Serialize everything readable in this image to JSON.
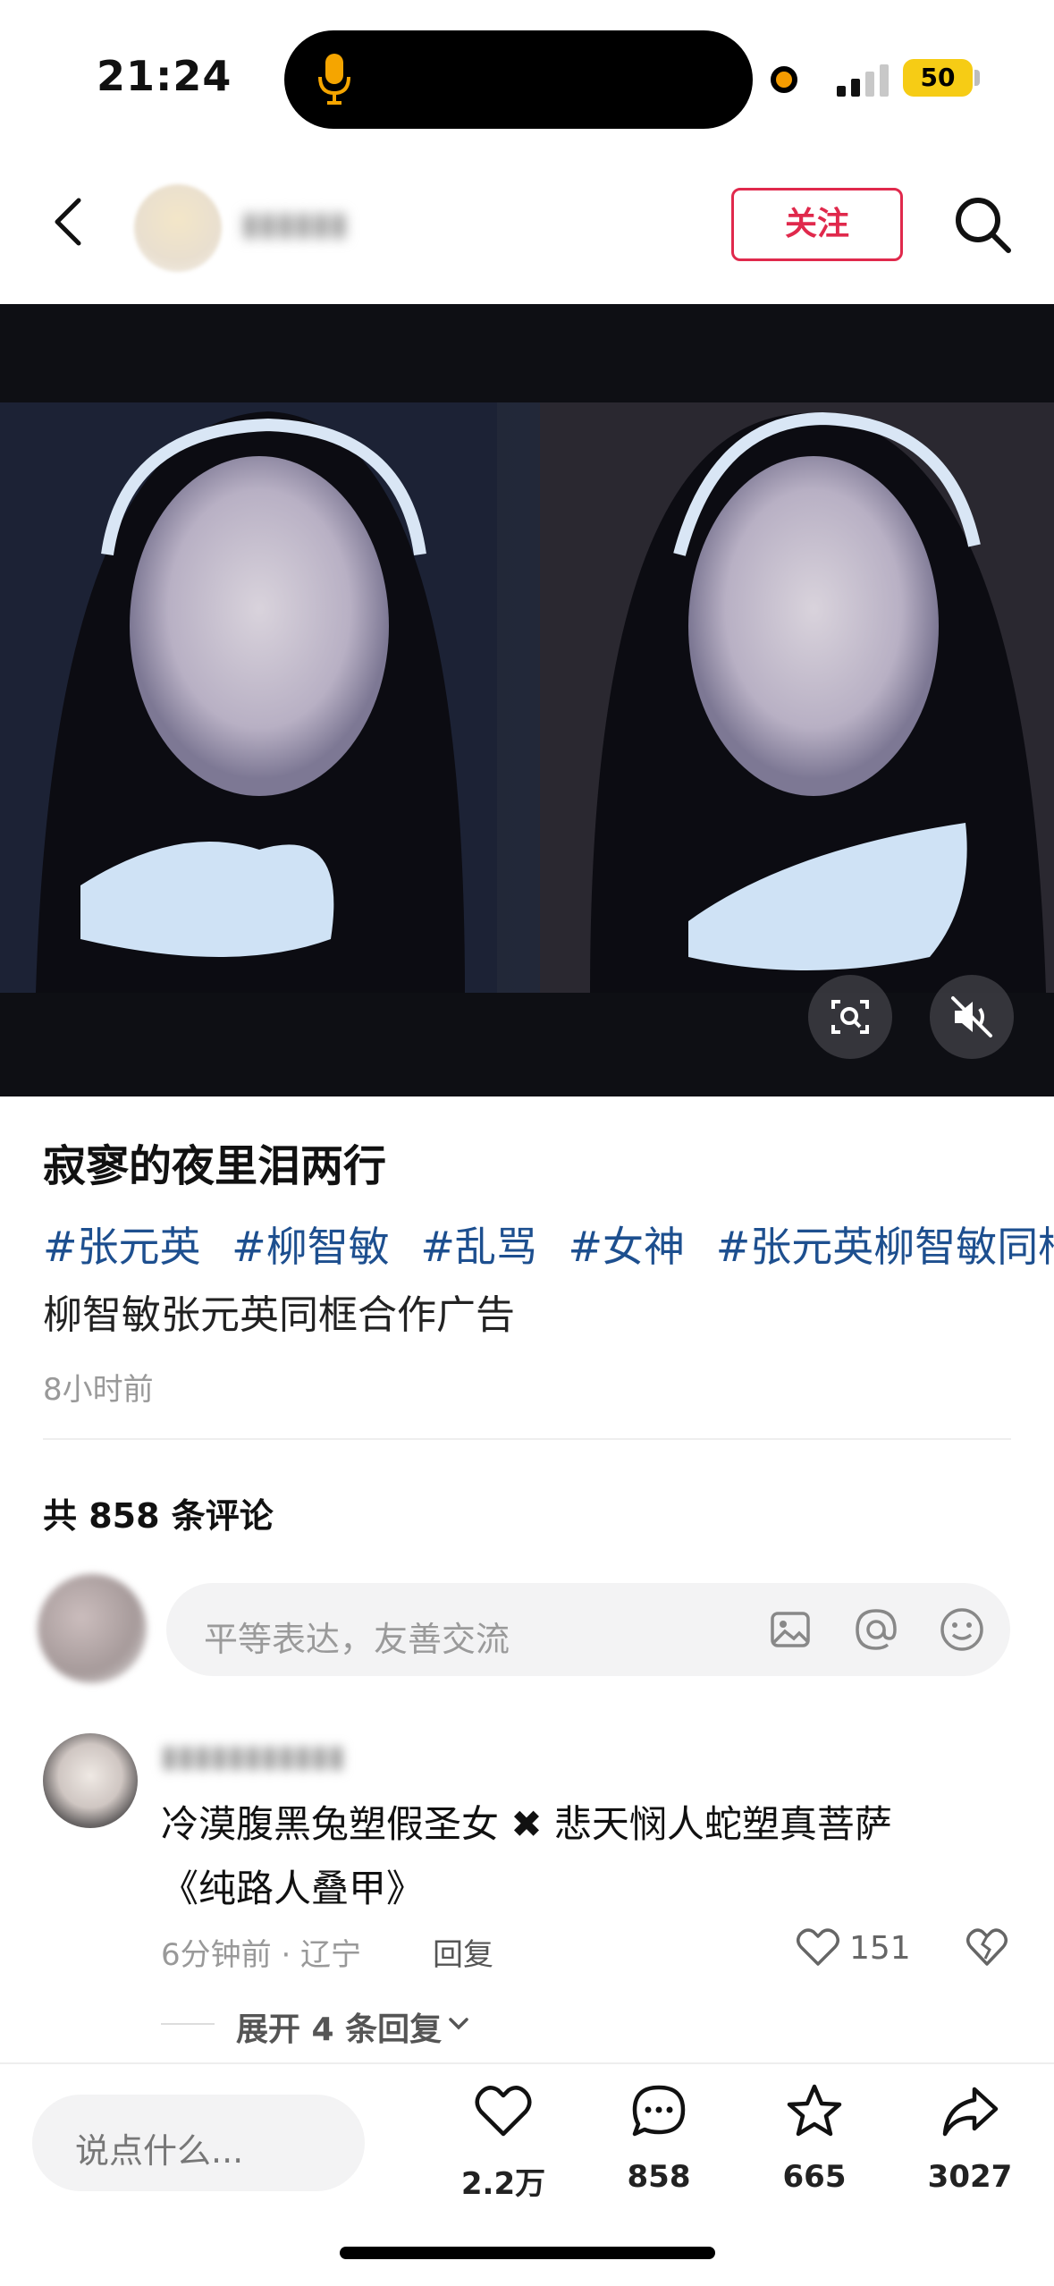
{
  "status_bar": {
    "time": "21:24",
    "battery": "50"
  },
  "header": {
    "follow_label": "关注"
  },
  "post": {
    "title": "寂寥的夜里泪两行",
    "tags": [
      "#张元英",
      "#柳智敏",
      "#乱骂",
      "#女神",
      "#张元英柳智敏同框"
    ],
    "description": "柳智敏张元英同框合作广告",
    "time": "8小时前"
  },
  "comments_section": {
    "count_label": "共 858 条评论",
    "input_placeholder": "平等表达，友善交流",
    "comment": {
      "line1": "冷漠腹黑兔塑假圣女 ✖ 悲天悯人蛇塑真菩萨",
      "line2": "《纯路人叠甲》",
      "meta": "6分钟前 · 辽宁",
      "reply_label": "回复",
      "likes": "151",
      "expand_label": "展开 4 条回复"
    }
  },
  "bottom_bar": {
    "input_placeholder": "说点什么...",
    "like_count": "2.2万",
    "comment_count": "858",
    "favorite_count": "665",
    "share_count": "3027"
  },
  "colors": {
    "accent": "#e0294c",
    "tag": "#1d4f8f",
    "battery": "#f6cc15"
  }
}
